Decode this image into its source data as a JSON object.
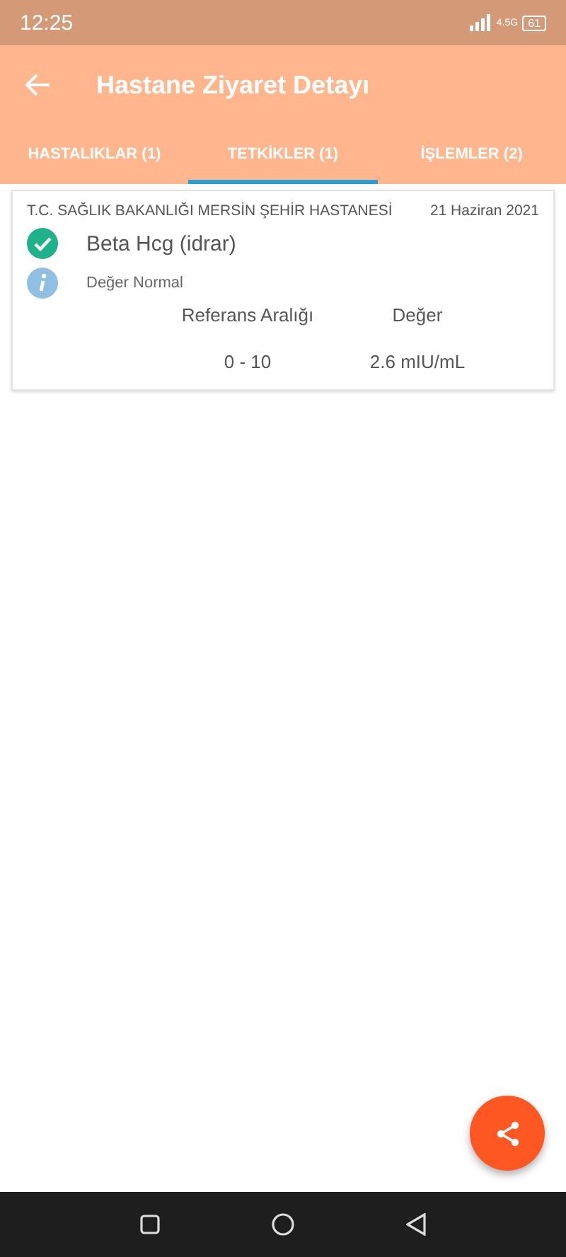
{
  "status_bar": {
    "time": "12:25",
    "network": "4.5G",
    "battery": "61"
  },
  "app_bar": {
    "title": "Hastane Ziyaret Detayı"
  },
  "tabs": [
    {
      "label": "HASTALIKLAR (1)",
      "selected": false
    },
    {
      "label": "TETKİKLER (1)",
      "selected": true
    },
    {
      "label": "İŞLEMLER (2)",
      "selected": false
    }
  ],
  "results": [
    {
      "hospital": "T.C. SAĞLIK BAKANLIĞI MERSİN ŞEHİR HASTANESİ",
      "date": "21 Haziran 2021",
      "test": "Beta Hcg (idrar)",
      "note": "Değer Normal",
      "range_label": "Referans Aralığı",
      "value_label": "Değer",
      "range": "0 - 10",
      "value": "2.6 mIU/mL"
    }
  ]
}
